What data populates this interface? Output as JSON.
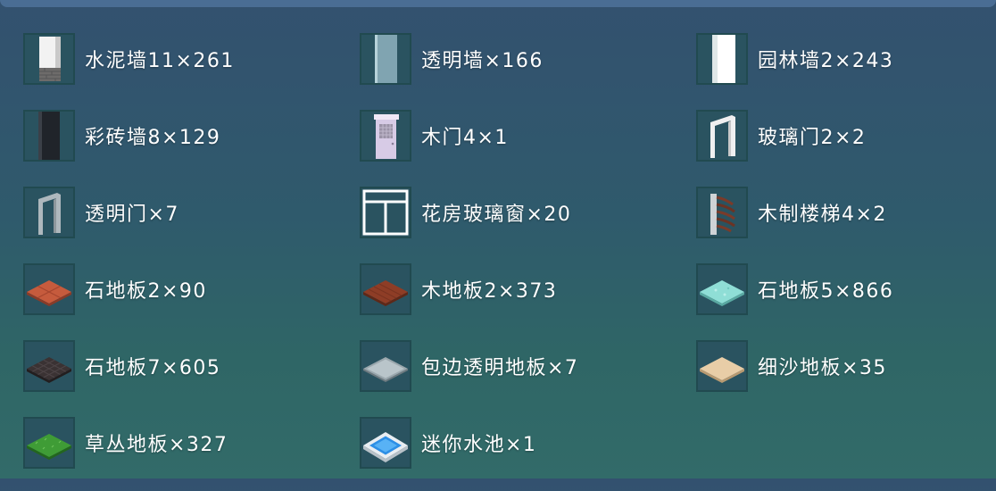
{
  "inventory": {
    "items": [
      {
        "name": "水泥墙11×261",
        "icon": "concrete-wall-icon"
      },
      {
        "name": "透明墙×166",
        "icon": "transparent-wall-icon"
      },
      {
        "name": "园林墙2×243",
        "icon": "garden-wall-icon"
      },
      {
        "name": "彩砖墙8×129",
        "icon": "color-brick-wall-icon"
      },
      {
        "name": "木门4×1",
        "icon": "wooden-door-icon"
      },
      {
        "name": "玻璃门2×2",
        "icon": "glass-door-icon"
      },
      {
        "name": "透明门×7",
        "icon": "transparent-door-icon"
      },
      {
        "name": "花房玻璃窗×20",
        "icon": "greenhouse-window-icon"
      },
      {
        "name": "木制楼梯4×2",
        "icon": "wooden-stairs-icon"
      },
      {
        "name": "石地板2×90",
        "icon": "stone-floor-red-icon"
      },
      {
        "name": "木地板2×373",
        "icon": "wood-floor-icon"
      },
      {
        "name": "石地板5×866",
        "icon": "stone-floor-cyan-icon"
      },
      {
        "name": "石地板7×605",
        "icon": "stone-floor-dark-icon"
      },
      {
        "name": "包边透明地板×7",
        "icon": "edged-transparent-floor-icon"
      },
      {
        "name": "细沙地板×35",
        "icon": "fine-sand-floor-icon"
      },
      {
        "name": "草丛地板×327",
        "icon": "grass-floor-icon"
      },
      {
        "name": "迷你水池×1",
        "icon": "mini-pool-icon"
      }
    ]
  }
}
